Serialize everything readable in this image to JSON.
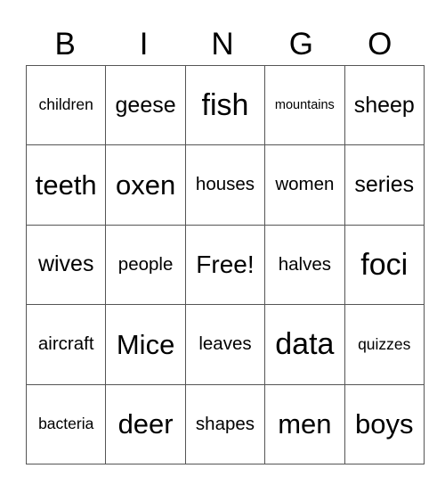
{
  "header": {
    "letters": [
      "B",
      "I",
      "N",
      "G",
      "O"
    ]
  },
  "card": {
    "rows": [
      [
        "children",
        "geese",
        "fish",
        "mountains",
        "sheep"
      ],
      [
        "teeth",
        "oxen",
        "houses",
        "women",
        "series"
      ],
      [
        "wives",
        "people",
        "Free!",
        "halves",
        "foci"
      ],
      [
        "aircraft",
        "Mice",
        "leaves",
        "data",
        "quizzes"
      ],
      [
        "bacteria",
        "deer",
        "shapes",
        "men",
        "boys"
      ]
    ],
    "free_space": {
      "row": 2,
      "col": 2,
      "label": "Free!"
    }
  }
}
